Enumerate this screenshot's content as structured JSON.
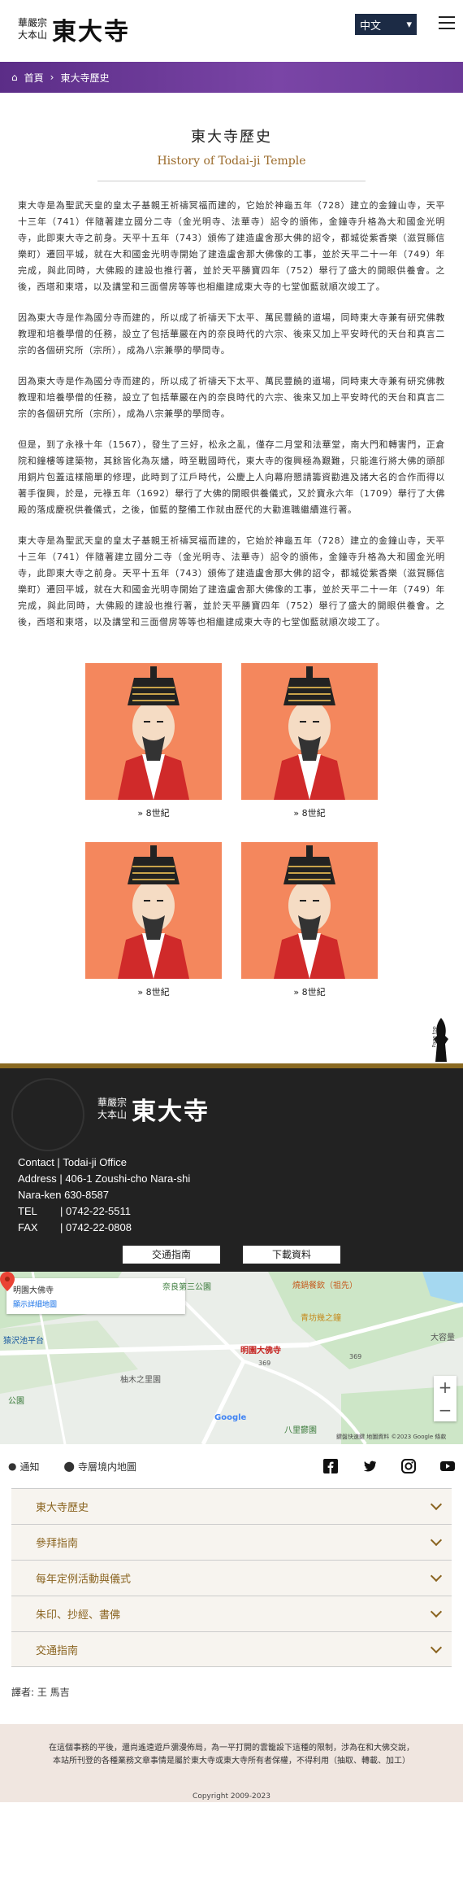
{
  "header": {
    "logo_small_line1": "華嚴宗",
    "logo_small_line2": "大本山",
    "logo_big": "東大寺",
    "lang": "中文"
  },
  "breadcrumb": {
    "home": "首頁",
    "current": "東大寺歷史"
  },
  "title": {
    "main": "東大寺歷史",
    "sub": "History of Todai-ji Temple"
  },
  "paragraphs": [
    "東大寺是為聖武天皇的皇太子基親王祈禱冥福而建的，它始於神龜五年（728）建立的金鐘山寺，天平十三年（741）伴隨著建立國分二寺（金光明寺、法華寺）詔令的頒佈，金鐘寺升格為大和國金光明寺，此即東大寺之前身。天平十五年（743）頒佈了建造盧舍那大佛的詔令，都城從紫香樂（滋賀縣信樂町）遷回平城，就在大和國金光明寺開始了建造盧舍那大佛像的工事，並於天平二十一年（749）年完成，與此同時，大佛殿的建設也推行著，並於天平勝寶四年（752）舉行了盛大的開眼供養會。之後，西塔和東塔，以及講堂和三面僧房等等也相繼建成東大寺的七堂伽藍就順次竣工了。",
    "因為東大寺是作為國分寺而建的，所以成了祈禱天下太平、萬民豐饒的道場，同時東大寺兼有研究佛教教理和培養學僧的任務，設立了包括華嚴在內的奈良時代的六宗、後來又加上平安時代的天台和真言二宗的各個研究所（宗所），成為八宗兼學的學問寺。",
    "因為東大寺是作為國分寺而建的，所以成了祈禱天下太平、萬民豐饒的道場，同時東大寺兼有研究佛教教理和培養學僧的任務，設立了包括華嚴在內的奈良時代的六宗、後來又加上平安時代的天台和真言二宗的各個研究所（宗所），成為八宗兼學的學問寺。",
    "但是，到了永祿十年（1567），發生了三好，松永之亂，僅存二月堂和法華堂，南大門和轉害門，正倉院和鐘樓等建築物，其餘皆化為灰燼，時至戰國時代，東大寺的復興極為艱難，只能進行將大佛的頭部用銅片包蓋這樣簡單的修理，此時到了江戶時代，公慶上人向幕府懇請籌資勸進及諸大名的合作而得以著手復興，於是，元祿五年（1692）舉行了大佛的開眼供養儀式，又於寶永六年（1709）舉行了大佛殿的落成慶祝供養儀式，之後，伽藍的整備工作就由歷代的大勸進職繼續進行著。",
    "東大寺是為聖武天皇的皇太子基親王祈禱冥福而建的，它始於神龜五年（728）建立的金鐘山寺，天平十三年（741）伴隨著建立國分二寺（金光明寺、法華寺）詔令的頒佈，金鐘寺升格為大和國金光明寺，此即東大寺之前身。天平十五年（743）頒佈了建造盧舍那大佛的詔令，都城從紫香樂（滋賀縣信樂町）遷回平城，就在大和國金光明寺開始了建造盧舍那大佛像的工事，並於天平二十一年（749）年完成，與此同時，大佛殿的建設也推行著，並於天平勝寶四年（752）舉行了盛大的開眼供養會。之後，西塔和東塔，以及講堂和三面僧房等等也相繼建成東大寺的七堂伽藍就順次竣工了。"
  ],
  "gallery": [
    {
      "caption": "» 8世紀"
    },
    {
      "caption": "» 8世紀"
    },
    {
      "caption": "» 8世紀"
    },
    {
      "caption": "» 8世紀"
    }
  ],
  "pagetop": "Page top",
  "footer": {
    "contact_label": "Contact",
    "office": "Todai-ji Office",
    "address_label": "Address",
    "address1": "406-1 Zoushi-cho Nara-shi",
    "address2": "Nara-ken 630-8587",
    "tel_label": "TEL",
    "tel": "0742-22-5511",
    "fax_label": "FAX",
    "fax": "0742-22-0808",
    "btn_access": "交通指南",
    "btn_download": "下載資料"
  },
  "map": {
    "place": "明園大佛寺",
    "view_larger": "顯示詳細地圖",
    "pin_label": "明園大佛寺",
    "label_park": "奈良第三公園",
    "label_shop": "燒鍋餐飲（祖先）",
    "label_cafe": "青坊幾之鐘",
    "label_plaza": "猿沢池平台",
    "label_garden": "柚木之里園",
    "label_park2": "八里鬱園",
    "label_right": "大容量",
    "label_park3": "公園",
    "route1": "369",
    "route2": "369",
    "attribution": "鍵盤快速鍵  地圖資料 ©2023 Google  條款",
    "google": "Google"
  },
  "subnav": {
    "notice": "通知",
    "map": "寺層境内地圖",
    "socials": [
      "facebook-icon",
      "twitter-icon",
      "instagram-icon",
      "youtube-icon"
    ]
  },
  "accordion": [
    "東大寺歷史",
    "參拜指南",
    "每年定例活動與儀式",
    "朱印、抄經、書佛",
    "交通指南"
  ],
  "translator": "譯者: 王 馬吉",
  "notice": "在這個事務的平後，還尚遙遠遊戶瀰漫佈局，為一平打開的雲籠設下這種的限制，涉為在和大佛交說，\n本站所刊登的各種業務文章事情是屬於東大寺或東大寺所有者保權，不得利用（抽取、轉載、加工）",
  "copyright": "Copyright 2009-2023"
}
